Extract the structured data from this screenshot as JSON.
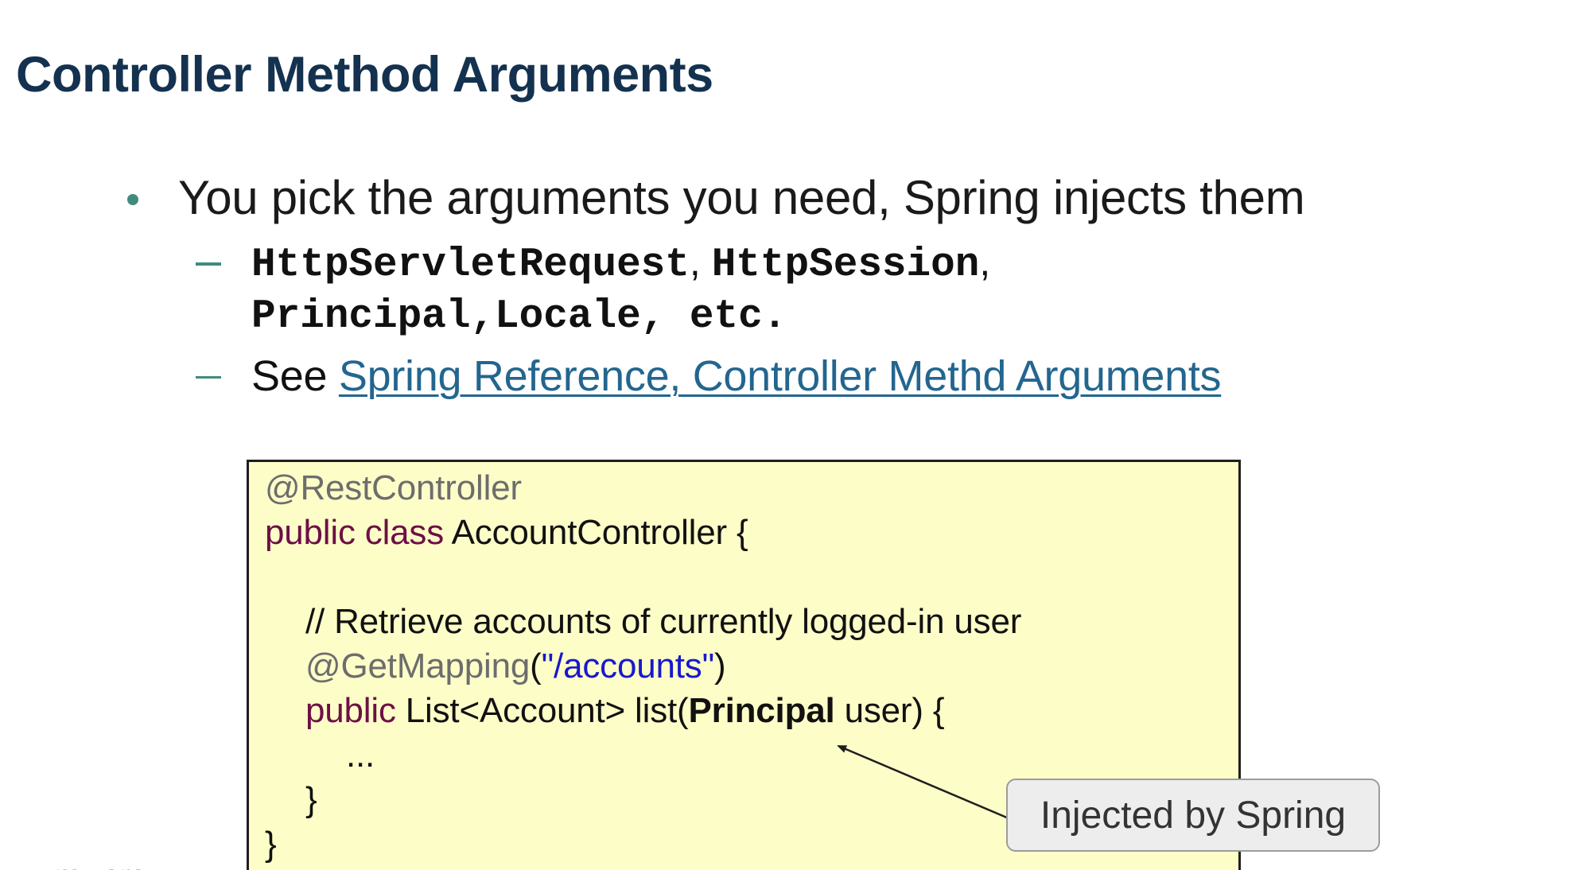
{
  "slide": {
    "title": "Controller Method Arguments",
    "bullet": "You pick the arguments you need, Spring injects them",
    "subbullet_1": {
      "line1_item1": "HttpServletRequest",
      "line1_sep1": ", ",
      "line1_item2": "HttpSession",
      "line1_sep2": ",",
      "line2": "Principal,Locale, etc."
    },
    "subbullet_2": {
      "prefix": "See ",
      "link_text": "Spring Reference, Controller Methd Arguments"
    }
  },
  "code": {
    "line1_annotation": "@RestController",
    "line2_keyword": "public class",
    "line2_rest": " AccountController {",
    "line4_comment": "// Retrieve accounts of currently logged-in user",
    "line5_annotation": "@GetMapping",
    "line5_open": "(",
    "line5_string": "\"/accounts\"",
    "line5_close": ")",
    "line6_keyword": "public",
    "line6_mid": " List<Account> list(",
    "line6_bold": "Principal",
    "line6_end": " user) {",
    "line7": "...",
    "line8": "}",
    "line9": "}"
  },
  "callout": {
    "text": "Injected by Spring"
  },
  "colors": {
    "title": "#14324f",
    "accent": "#3f8c7d",
    "link": "#23668f",
    "code_bg": "#fdfdc8",
    "keyword": "#6e0f46",
    "annotation": "#6d6d6d",
    "string": "#1818d0"
  }
}
